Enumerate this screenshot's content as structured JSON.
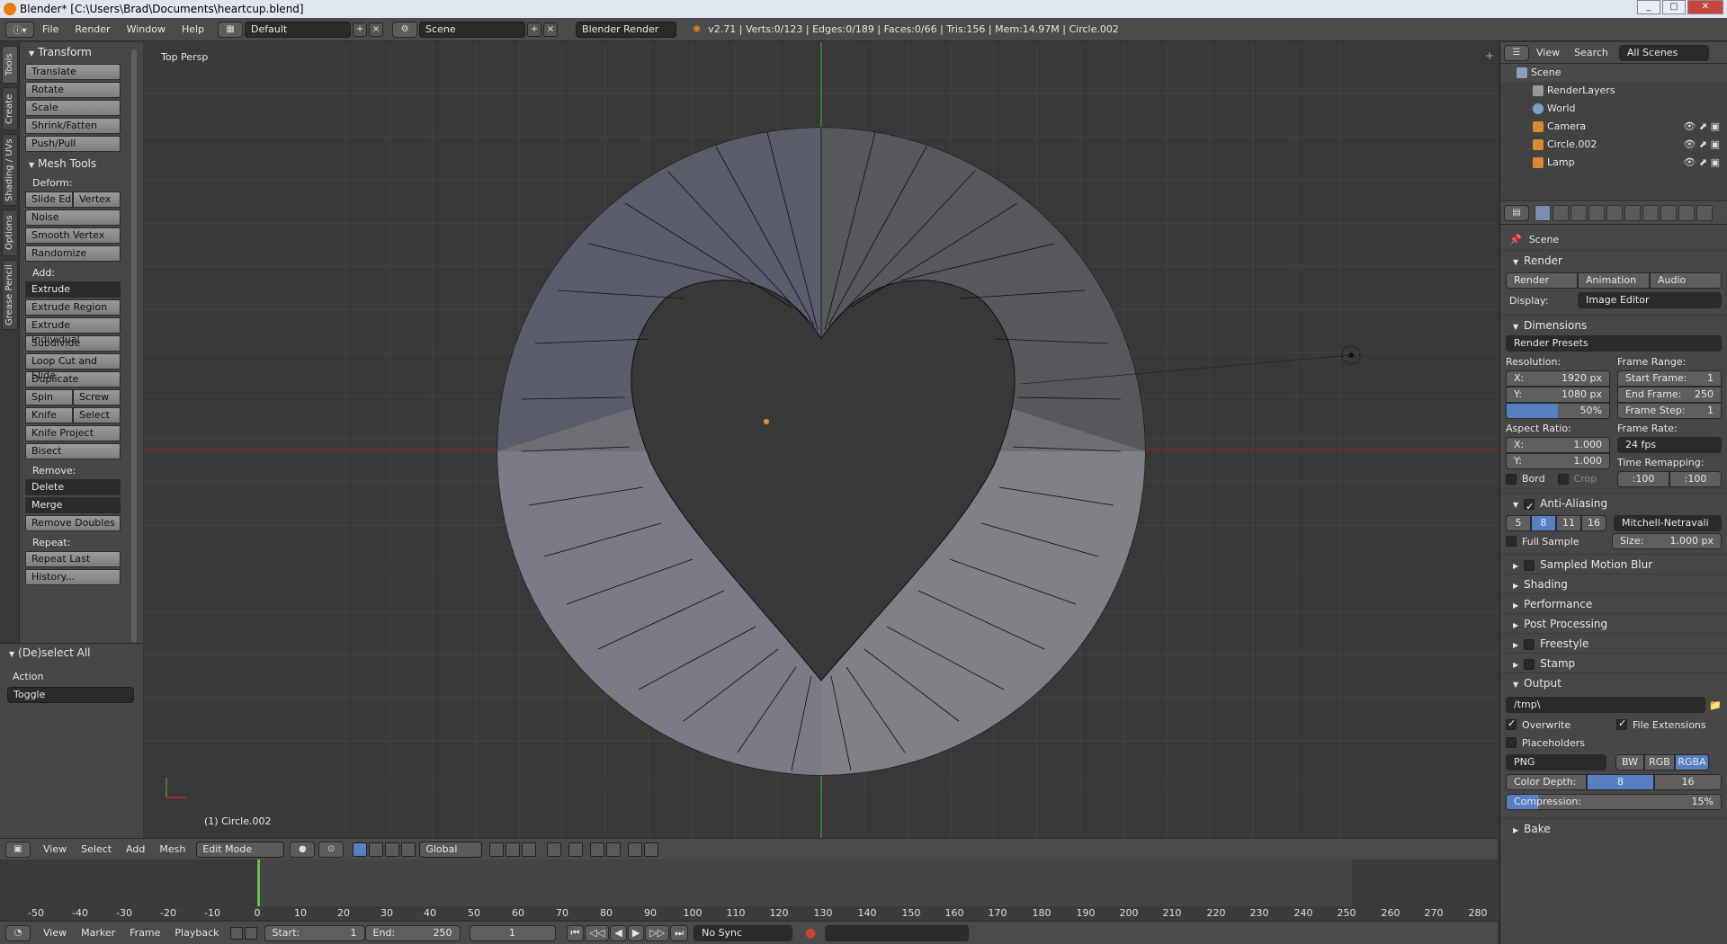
{
  "window": {
    "title": "Blender* [C:\\Users\\Brad\\Documents\\heartcup.blend]",
    "buttons": [
      "_",
      "□",
      "✕"
    ]
  },
  "topbar": {
    "menus": [
      "File",
      "Render",
      "Window",
      "Help"
    ],
    "layout": "Default",
    "scene": "Scene",
    "engine": "Blender Render",
    "stats": "v2.71 | Verts:0/123 | Edges:0/189 | Faces:0/66 | Tris:156 | Mem:14.97M | Circle.002"
  },
  "tabs": [
    "Tools",
    "Create",
    "Shading / UVs",
    "Options",
    "Grease Pencil"
  ],
  "toolshelf": {
    "transform": {
      "title": "Transform",
      "buttons": [
        "Translate",
        "Rotate",
        "Scale",
        "Shrink/Fatten",
        "Push/Pull"
      ]
    },
    "mesh_tools": {
      "title": "Mesh Tools",
      "deform_label": "Deform:",
      "slide_edge": "Slide Ed",
      "vertex": "Vertex",
      "deform": [
        "Noise",
        "Smooth Vertex",
        "Randomize"
      ],
      "add_label": "Add:",
      "extrude": "Extrude",
      "add": [
        "Extrude Region",
        "Extrude Individual",
        "Subdivide",
        "Loop Cut and Slide",
        "Duplicate"
      ],
      "spin": "Spin",
      "screw": "Screw",
      "knife": "Knife",
      "select": "Select",
      "add2": [
        "Knife Project",
        "Bisect"
      ],
      "remove_label": "Remove:",
      "delete": "Delete",
      "merge": "Merge",
      "remove_doubles": "Remove Doubles",
      "repeat_label": "Repeat:",
      "repeat": [
        "Repeat Last",
        "History..."
      ]
    },
    "operator": {
      "title": "(De)select All",
      "action_label": "Action",
      "action_value": "Toggle"
    }
  },
  "viewport": {
    "view_name": "Top Persp",
    "object_label": "(1) Circle.002"
  },
  "viewport_header": {
    "menus": [
      "View",
      "Select",
      "Add",
      "Mesh"
    ],
    "mode": "Edit Mode",
    "orientation": "Global"
  },
  "timeline": {
    "ticks": [
      "-50",
      "-40",
      "-30",
      "-20",
      "-10",
      "0",
      "10",
      "20",
      "30",
      "40",
      "50",
      "60",
      "70",
      "80",
      "90",
      "100",
      "110",
      "120",
      "130",
      "140",
      "150",
      "160",
      "170",
      "180",
      "190",
      "200",
      "210",
      "220",
      "230",
      "240",
      "250",
      "260",
      "270",
      "280"
    ],
    "menus": [
      "View",
      "Marker",
      "Frame",
      "Playback"
    ],
    "start_label": "Start:",
    "start": "1",
    "end_label": "End:",
    "end": "250",
    "current": "1",
    "sync": "No Sync"
  },
  "outliner": {
    "menus": [
      "View",
      "Search"
    ],
    "filter": "All Scenes",
    "items": [
      "Scene",
      "RenderLayers",
      "World",
      "Camera",
      "Circle.002",
      "Lamp"
    ]
  },
  "properties": {
    "context": "Scene",
    "render_title": "Render",
    "render_buttons": [
      "Render",
      "Animation",
      "Audio"
    ],
    "display_label": "Display:",
    "display_value": "Image Editor",
    "dimensions_title": "Dimensions",
    "presets": "Render Presets",
    "resolution_label": "Resolution:",
    "res_x_label": "X:",
    "res_x": "1920 px",
    "res_y_label": "Y:",
    "res_y": "1080 px",
    "res_pct": "50%",
    "aspect_label": "Aspect Ratio:",
    "asp_x_label": "X:",
    "asp_x": "1.000",
    "asp_y_label": "Y:",
    "asp_y": "1.000",
    "bord": "Bord",
    "crop": "Crop",
    "frame_range_label": "Frame Range:",
    "start_frame_label": "Start Frame:",
    "start_frame": "1",
    "end_frame_label": "End Frame:",
    "end_frame": "250",
    "frame_step_label": "Frame Step:",
    "frame_step": "1",
    "frame_rate_label": "Frame Rate:",
    "frame_rate": "24 fps",
    "time_remap_label": "Time Remapping:",
    "remap_old": ":100",
    "remap_new": ":100",
    "aa_title": "Anti-Aliasing",
    "aa_samples": [
      "5",
      "8",
      "11",
      "16"
    ],
    "aa_filter": "Mitchell-Netravali",
    "full_sample": "Full Sample",
    "size_label": "Size:",
    "size_value": "1.000 px",
    "collapsed": [
      "Sampled Motion Blur",
      "Shading",
      "Performance",
      "Post Processing",
      "Freestyle",
      "Stamp"
    ],
    "output_title": "Output",
    "output_path": "/tmp\\",
    "overwrite": "Overwrite",
    "file_ext": "File Extensions",
    "placeholders": "Placeholders",
    "format": "PNG",
    "color_modes": [
      "BW",
      "RGB",
      "RGBA"
    ],
    "color_depth_label": "Color Depth:",
    "depth_8": "8",
    "depth_16": "16",
    "compression_label": "Compression:",
    "compression": "15%",
    "bake_title": "Bake"
  }
}
